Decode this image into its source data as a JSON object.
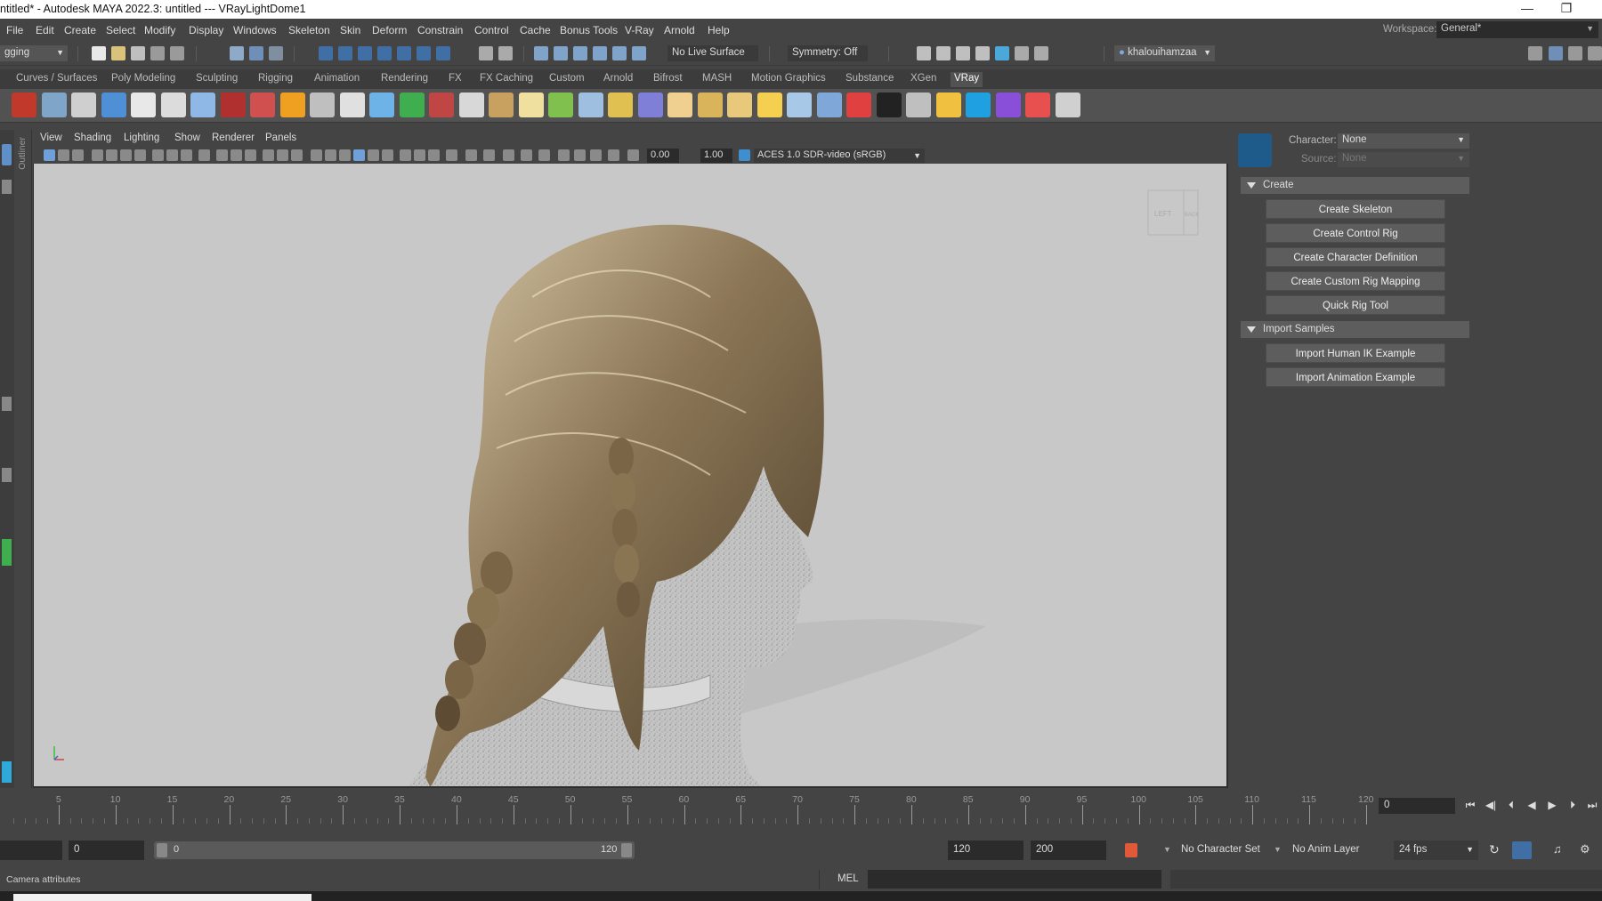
{
  "window": {
    "title": "ntitled* - Autodesk MAYA 2022.3: untitled   ---   VRayLightDome1",
    "minimize_icon": "minimize-icon",
    "restore_icon": "restore-icon"
  },
  "menus": [
    "File",
    "Edit",
    "Create",
    "Select",
    "Modify",
    "Display",
    "Windows",
    "Skeleton",
    "Skin",
    "Deform",
    "Constrain",
    "Control",
    "Cache",
    "Bonus Tools",
    "V-Ray",
    "Arnold",
    "Help"
  ],
  "workspace": {
    "label": "Workspace:",
    "value": "General*"
  },
  "statusline": {
    "menuset": "gging",
    "live_surface": "No Live Surface",
    "symmetry": "Symmetry: Off",
    "user": "khalouihamzaa"
  },
  "shelf_tabs": [
    "Curves / Surfaces",
    "Poly Modeling",
    "Sculpting",
    "Rigging",
    "Animation",
    "Rendering",
    "FX",
    "FX Caching",
    "Custom",
    "Arnold",
    "Bifrost",
    "MASH",
    "Motion Graphics",
    "Substance",
    "XGen",
    "VRay"
  ],
  "shelf_active": "VRay",
  "shelf_icon_colors": [
    "#c0392b",
    "#7fa6c9",
    "#cfcfcf",
    "#4f8fd6",
    "#e8e8e8",
    "#dcdcdc",
    "#8fb8e6",
    "#b03030",
    "#d05050",
    "#f0a020",
    "#bfbfbf",
    "#e0e0e0",
    "#6db3e8",
    "#3fae4f",
    "#c04545",
    "#d8d8d8",
    "#c8a060",
    "#f0e0a0",
    "#7fc04f",
    "#9fbfe0",
    "#e0c050",
    "#7f7fd8",
    "#f0d090",
    "#d9b45a",
    "#e8c87a",
    "#f5d050",
    "#a8c8e8",
    "#7fa8d8",
    "#e04040",
    "#222222",
    "#bfbfbf",
    "#f0c040",
    "#1fa0e0",
    "#8a4fd8",
    "#e85050",
    "#d0d0d0"
  ],
  "outliner_label": "Outliner",
  "viewport": {
    "menus": [
      "View",
      "Shading",
      "Lighting",
      "Show",
      "Renderer",
      "Panels"
    ],
    "exposure": "0.00",
    "gamma": "1.00",
    "color_space": "ACES 1.0 SDR-video (sRGB)",
    "viewcube": [
      "LEFT",
      "BACK"
    ]
  },
  "hik": {
    "character_label": "Character:",
    "character_value": "None",
    "source_label": "Source:",
    "source_value": "None",
    "create_header": "Create",
    "create_buttons": [
      "Create Skeleton",
      "Create Control Rig",
      "Create Character Definition",
      "Create Custom Rig Mapping",
      "Quick Rig Tool"
    ],
    "import_header": "Import Samples",
    "import_buttons": [
      "Import Human IK Example",
      "Import Animation Example"
    ]
  },
  "timeline": {
    "ticks": [
      "5",
      "10",
      "15",
      "20",
      "25",
      "30",
      "35",
      "40",
      "45",
      "50",
      "55",
      "60",
      "65",
      "70",
      "75",
      "80",
      "85",
      "90",
      "95",
      "100",
      "105",
      "110",
      "115",
      "120"
    ],
    "current_frame": "0"
  },
  "range": {
    "start": "0",
    "slider_start": "0",
    "slider_end": "120",
    "end": "120",
    "anim_end": "200",
    "character_set": "No Character Set",
    "anim_layer": "No Anim Layer",
    "fps": "24 fps"
  },
  "cmdline": {
    "status": "Camera attributes",
    "lang": "MEL"
  }
}
